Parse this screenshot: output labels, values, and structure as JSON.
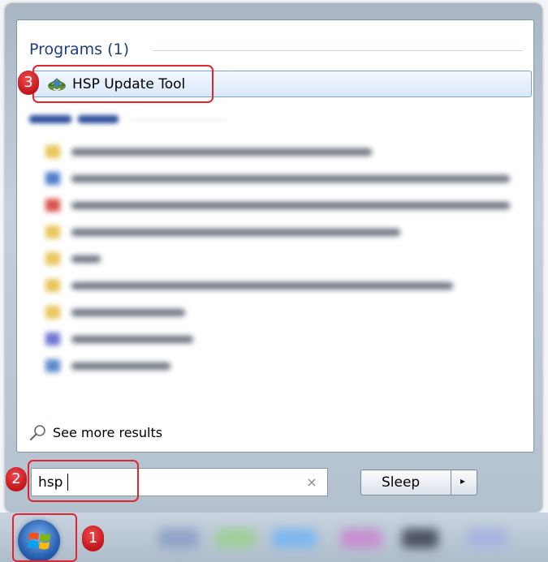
{
  "start_menu": {
    "programs_header": "Programs (1)",
    "program_item": "HSP Update Tool",
    "see_more_results": "See more results",
    "search_value": "hsp",
    "clear_glyph": "×",
    "sleep_label": "Sleep",
    "sleep_options_glyph": "▸"
  },
  "annotations": {
    "step_1": "1",
    "step_2": "2",
    "step_3": "3"
  },
  "icons": {
    "program": "hsp-update-tool-icon",
    "search": "magnifier-icon",
    "start": "windows-start-orb"
  },
  "colors": {
    "annotation": "#e0262c",
    "header_text": "#1e3c86",
    "selection_border": "#7da2ce"
  }
}
